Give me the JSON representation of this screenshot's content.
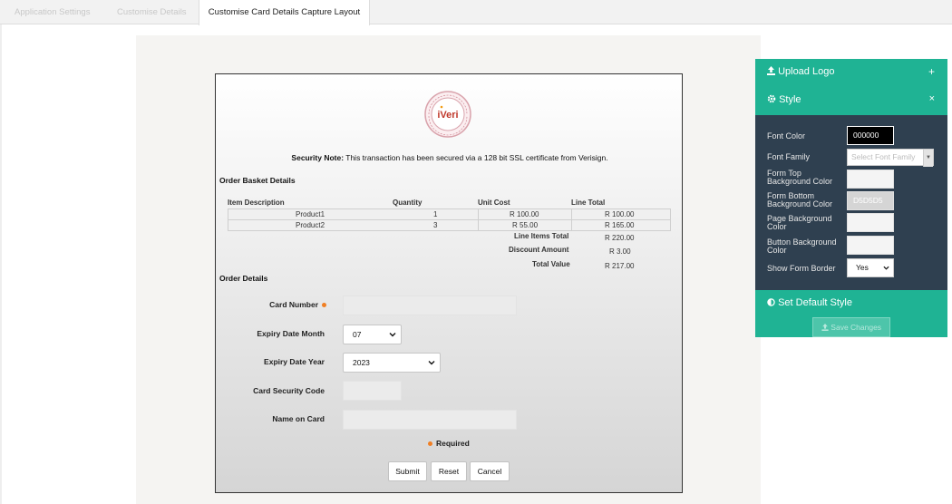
{
  "tabs": {
    "app_settings": "Application Settings",
    "customise_details": "Customise Details",
    "capture_layout": "Customise Card Details Capture Layout"
  },
  "form": {
    "security_note_bold": "Security Note:",
    "security_note_text": " This transaction has been secured via a 128 bit SSL certificate from Verisign.",
    "basket_title": "Order Basket Details",
    "columns": [
      "Item Description",
      "Quantity",
      "Unit Cost",
      "Line Total"
    ],
    "rows": [
      {
        "item": "Product1",
        "qty": "1",
        "unit": "R 100.00",
        "total": "R 100.00"
      },
      {
        "item": "Product2",
        "qty": "3",
        "unit": "R 55.00",
        "total": "R 165.00"
      }
    ],
    "summary": [
      {
        "label": "Line Items Total",
        "value": "R 220.00"
      },
      {
        "label": "Discount Amount",
        "value": "R 3.00"
      },
      {
        "label": "Total Value",
        "value": "R 217.00"
      }
    ],
    "order_title": "Order Details",
    "card_number_label": "Card Number",
    "expiry_month_label": "Expiry Date Month",
    "expiry_month_value": "07",
    "expiry_year_label": "Expiry Date Year",
    "expiry_year_value": "2023",
    "csc_label": "Card Security Code",
    "name_label": "Name on Card",
    "required_label": "Required",
    "buttons": {
      "submit": "Submit",
      "reset": "Reset",
      "cancel": "Cancel"
    }
  },
  "panel": {
    "upload_logo": "Upload Logo",
    "style": "Style",
    "font_color_label": "Font Color",
    "font_color_value": "000000",
    "font_family_label": "Font Family",
    "font_family_placeholder": "Select Font Family",
    "form_top_bg_label_1": "Form Top",
    "form_top_bg_label_2": "Background Color",
    "form_bottom_bg_label_1": "Form Bottom",
    "form_bottom_bg_label_2": "Background Color",
    "form_bottom_bg_value": "D5D5D5",
    "page_bg_label_1": "Page Background",
    "page_bg_label_2": "Color",
    "button_bg_label_1": "Button Background",
    "button_bg_label_2": "Color",
    "show_border_label": "Show Form Border",
    "show_border_value": "Yes",
    "set_default": "Set Default Style",
    "save_changes": "Save Changes"
  },
  "colors": {
    "accent": "#1fb394",
    "panel_dark": "#2f4050",
    "required_dot": "#f07f24"
  }
}
